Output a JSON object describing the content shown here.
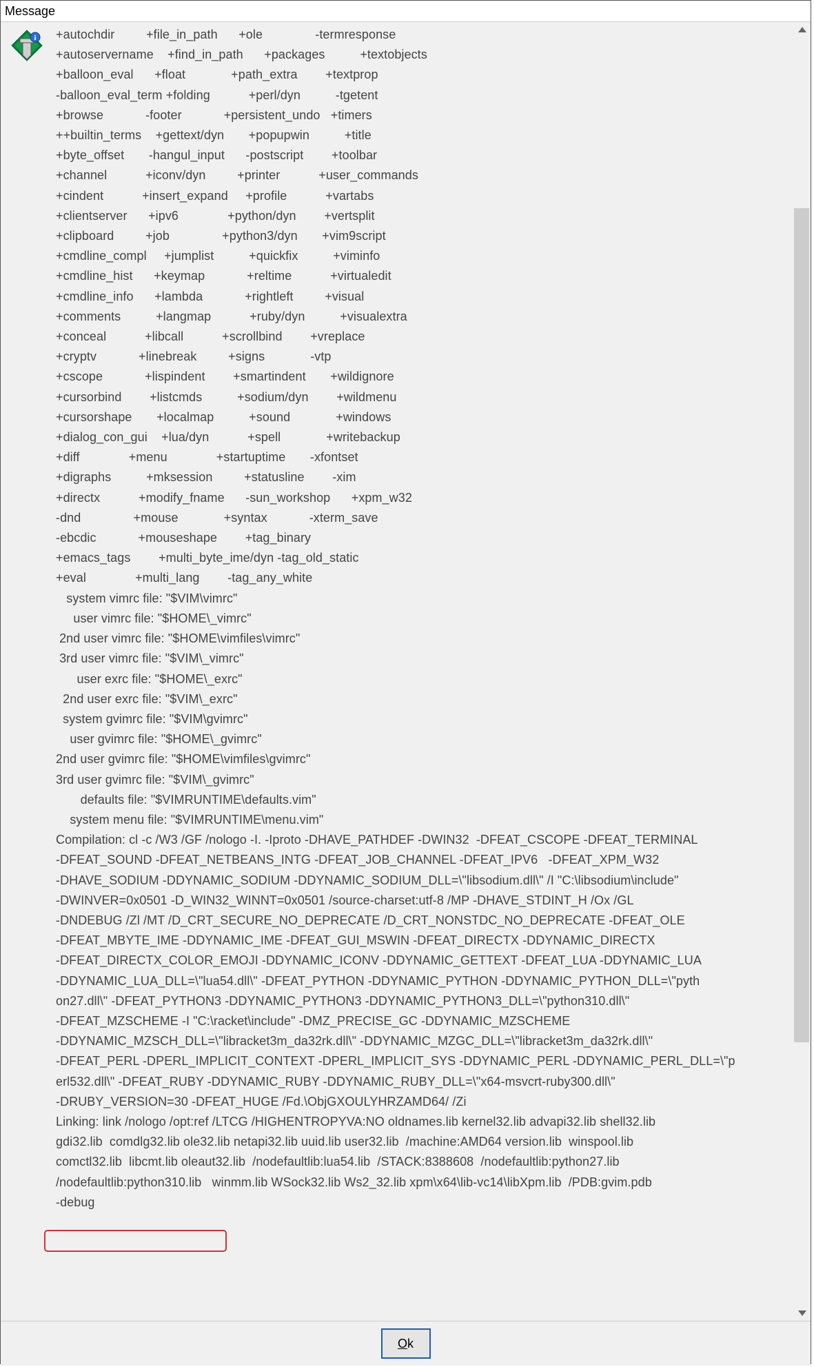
{
  "window": {
    "title": "Message"
  },
  "button": {
    "ok_label": "Ok"
  },
  "highlight": {
    "text": "/nodefaultlib:python310.lib"
  },
  "vim_icon": {
    "name": "vim-logo"
  },
  "features_table": [
    [
      "+autochdir",
      "+file_in_path",
      "+ole",
      "-termresponse"
    ],
    [
      "+autoservername",
      "+find_in_path",
      "+packages",
      "+textobjects"
    ],
    [
      "+balloon_eval",
      "+float",
      "+path_extra",
      "+textprop"
    ],
    [
      "-balloon_eval_term",
      "+folding",
      "+perl/dyn",
      "-tgetent"
    ],
    [
      "+browse",
      "-footer",
      "+persistent_undo",
      "+timers"
    ],
    [
      "++builtin_terms",
      "+gettext/dyn",
      "+popupwin",
      "+title"
    ],
    [
      "+byte_offset",
      "-hangul_input",
      "-postscript",
      "+toolbar"
    ],
    [
      "+channel",
      "+iconv/dyn",
      "+printer",
      "+user_commands"
    ],
    [
      "+cindent",
      "+insert_expand",
      "+profile",
      "+vartabs"
    ],
    [
      "+clientserver",
      "+ipv6",
      "+python/dyn",
      "+vertsplit"
    ],
    [
      "+clipboard",
      "+job",
      "+python3/dyn",
      "+vim9script"
    ],
    [
      "+cmdline_compl",
      "+jumplist",
      "+quickfix",
      "+viminfo"
    ],
    [
      "+cmdline_hist",
      "+keymap",
      "+reltime",
      "+virtualedit"
    ],
    [
      "+cmdline_info",
      "+lambda",
      "+rightleft",
      "+visual"
    ],
    [
      "+comments",
      "+langmap",
      "+ruby/dyn",
      "+visualextra"
    ],
    [
      "+conceal",
      "+libcall",
      "+scrollbind",
      "+vreplace"
    ],
    [
      "+cryptv",
      "+linebreak",
      "+signs",
      "-vtp"
    ],
    [
      "+cscope",
      "+lispindent",
      "+smartindent",
      "+wildignore"
    ],
    [
      "+cursorbind",
      "+listcmds",
      "+sodium/dyn",
      "+wildmenu"
    ],
    [
      "+cursorshape",
      "+localmap",
      "+sound",
      "+windows"
    ],
    [
      "+dialog_con_gui",
      "+lua/dyn",
      "+spell",
      "+writebackup"
    ],
    [
      "+diff",
      "+menu",
      "+startuptime",
      "-xfontset"
    ],
    [
      "+digraphs",
      "+mksession",
      "+statusline",
      "-xim"
    ],
    [
      "+directx",
      "+modify_fname",
      "-sun_workshop",
      "+xpm_w32"
    ],
    [
      "-dnd",
      "+mouse",
      "+syntax",
      "-xterm_save"
    ],
    [
      "-ebcdic",
      "+mouseshape",
      "+tag_binary",
      ""
    ],
    [
      "+emacs_tags",
      "+multi_byte_ime/dyn",
      "-tag_old_static",
      ""
    ],
    [
      "+eval",
      "+multi_lang",
      "-tag_any_white",
      ""
    ]
  ],
  "config_files": [
    "   system vimrc file: \"$VIM\\vimrc\"",
    "     user vimrc file: \"$HOME\\_vimrc\"",
    " 2nd user vimrc file: \"$HOME\\vimfiles\\vimrc\"",
    " 3rd user vimrc file: \"$VIM\\_vimrc\"",
    "      user exrc file: \"$HOME\\_exrc\"",
    "  2nd user exrc file: \"$VIM\\_exrc\"",
    "  system gvimrc file: \"$VIM\\gvimrc\"",
    "    user gvimrc file: \"$HOME\\_gvimrc\"",
    "2nd user gvimrc file: \"$HOME\\vimfiles\\gvimrc\"",
    "3rd user gvimrc file: \"$VIM\\_gvimrc\"",
    "       defaults file: \"$VIMRUNTIME\\defaults.vim\"",
    "    system menu file: \"$VIMRUNTIME\\menu.vim\""
  ],
  "compilation_lines": [
    "Compilation: cl -c /W3 /GF /nologo -I. -Iproto -DHAVE_PATHDEF -DWIN32  -DFEAT_CSCOPE -DFEAT_TERMINAL",
    "-DFEAT_SOUND -DFEAT_NETBEANS_INTG -DFEAT_JOB_CHANNEL -DFEAT_IPV6   -DFEAT_XPM_W32",
    "-DHAVE_SODIUM -DDYNAMIC_SODIUM -DDYNAMIC_SODIUM_DLL=\\\"libsodium.dll\\\" /I \"C:\\libsodium\\include\"",
    "-DWINVER=0x0501 -D_WIN32_WINNT=0x0501 /source-charset:utf-8 /MP -DHAVE_STDINT_H /Ox /GL",
    "-DNDEBUG /Zl /MT /D_CRT_SECURE_NO_DEPRECATE /D_CRT_NONSTDC_NO_DEPRECATE -DFEAT_OLE",
    "-DFEAT_MBYTE_IME -DDYNAMIC_IME -DFEAT_GUI_MSWIN -DFEAT_DIRECTX -DDYNAMIC_DIRECTX",
    "-DFEAT_DIRECTX_COLOR_EMOJI -DDYNAMIC_ICONV -DDYNAMIC_GETTEXT -DFEAT_LUA -DDYNAMIC_LUA",
    "-DDYNAMIC_LUA_DLL=\\\"lua54.dll\\\" -DFEAT_PYTHON -DDYNAMIC_PYTHON -DDYNAMIC_PYTHON_DLL=\\\"pyth",
    "on27.dll\\\" -DFEAT_PYTHON3 -DDYNAMIC_PYTHON3 -DDYNAMIC_PYTHON3_DLL=\\\"python310.dll\\\"",
    "-DFEAT_MZSCHEME -I \"C:\\racket\\include\" -DMZ_PRECISE_GC -DDYNAMIC_MZSCHEME",
    "-DDYNAMIC_MZSCH_DLL=\\\"libracket3m_da32rk.dll\\\" -DDYNAMIC_MZGC_DLL=\\\"libracket3m_da32rk.dll\\\"",
    "-DFEAT_PERL -DPERL_IMPLICIT_CONTEXT -DPERL_IMPLICIT_SYS -DDYNAMIC_PERL -DDYNAMIC_PERL_DLL=\\\"p",
    "erl532.dll\\\" -DFEAT_RUBY -DDYNAMIC_RUBY -DDYNAMIC_RUBY_DLL=\\\"x64-msvcrt-ruby300.dll\\\"",
    "-DRUBY_VERSION=30 -DFEAT_HUGE /Fd.\\ObjGXOULYHRZAMD64/ /Zi"
  ],
  "linking_lines": [
    "Linking: link /nologo /opt:ref /LTCG /HIGHENTROPYVA:NO oldnames.lib kernel32.lib advapi32.lib shell32.lib",
    "gdi32.lib  comdlg32.lib ole32.lib netapi32.lib uuid.lib user32.lib  /machine:AMD64 version.lib  winspool.lib",
    "comctl32.lib  libcmt.lib oleaut32.lib  /nodefaultlib:lua54.lib  /STACK:8388608  /nodefaultlib:python27.lib",
    "/nodefaultlib:python310.lib   winmm.lib WSock32.lib Ws2_32.lib xpm\\x64\\lib-vc14\\libXpm.lib  /PDB:gvim.pdb",
    "-debug"
  ]
}
